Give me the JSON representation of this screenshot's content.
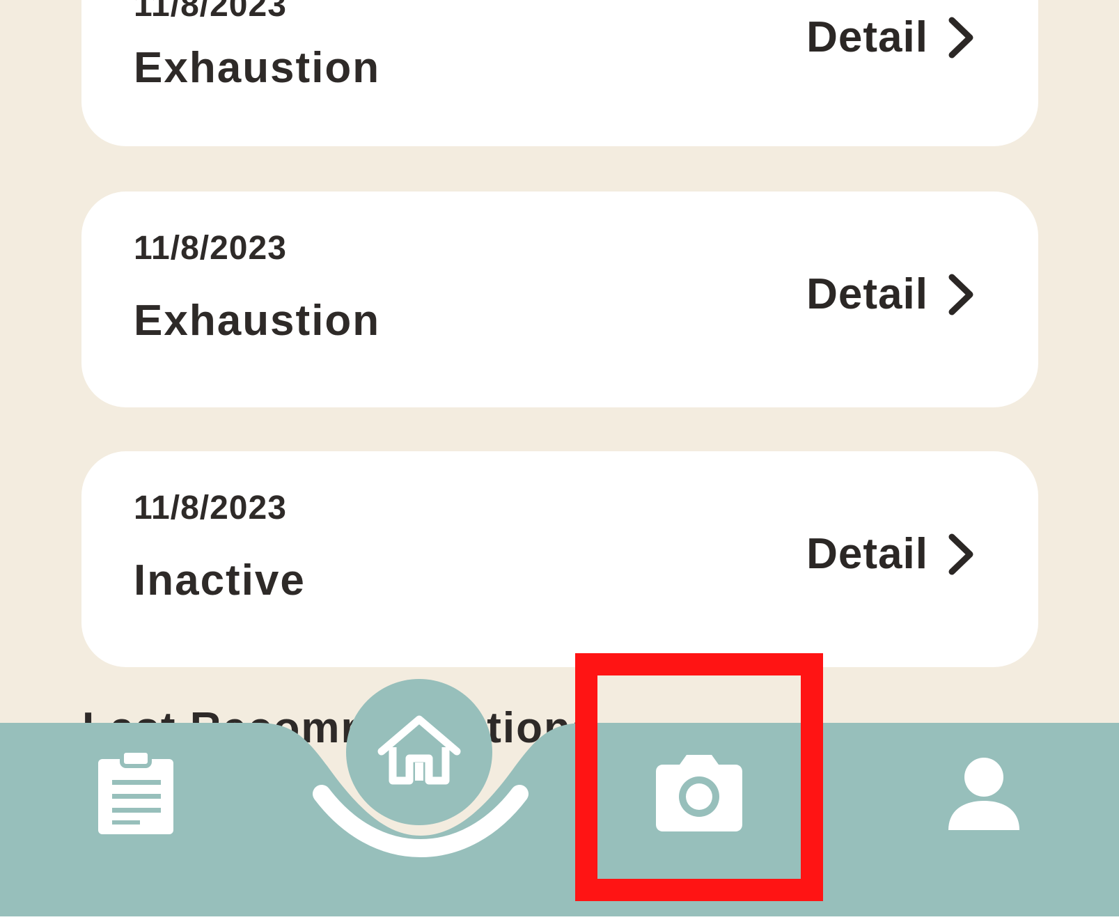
{
  "history": {
    "records": [
      {
        "date": "11/8/2023",
        "status": "Exhaustion",
        "detail_label": "Detail"
      },
      {
        "date": "11/8/2023",
        "status": "Exhaustion",
        "detail_label": "Detail"
      },
      {
        "date": "11/8/2023",
        "status": "Exhaustion",
        "detail_label": "Detail"
      },
      {
        "date": "11/8/2023",
        "status": "Inactive",
        "detail_label": "Detail"
      }
    ]
  },
  "section_peek": "Last Recommendations",
  "bottom_nav": {
    "items": [
      {
        "icon": "clipboard-icon"
      },
      {
        "icon": "home-icon"
      },
      {
        "icon": "camera-icon"
      },
      {
        "icon": "person-icon"
      }
    ]
  },
  "colors": {
    "background": "#f3ecdf",
    "card": "#ffffff",
    "nav": "#97bfbb",
    "highlight": "#ff1414",
    "text": "#2e2a28"
  }
}
